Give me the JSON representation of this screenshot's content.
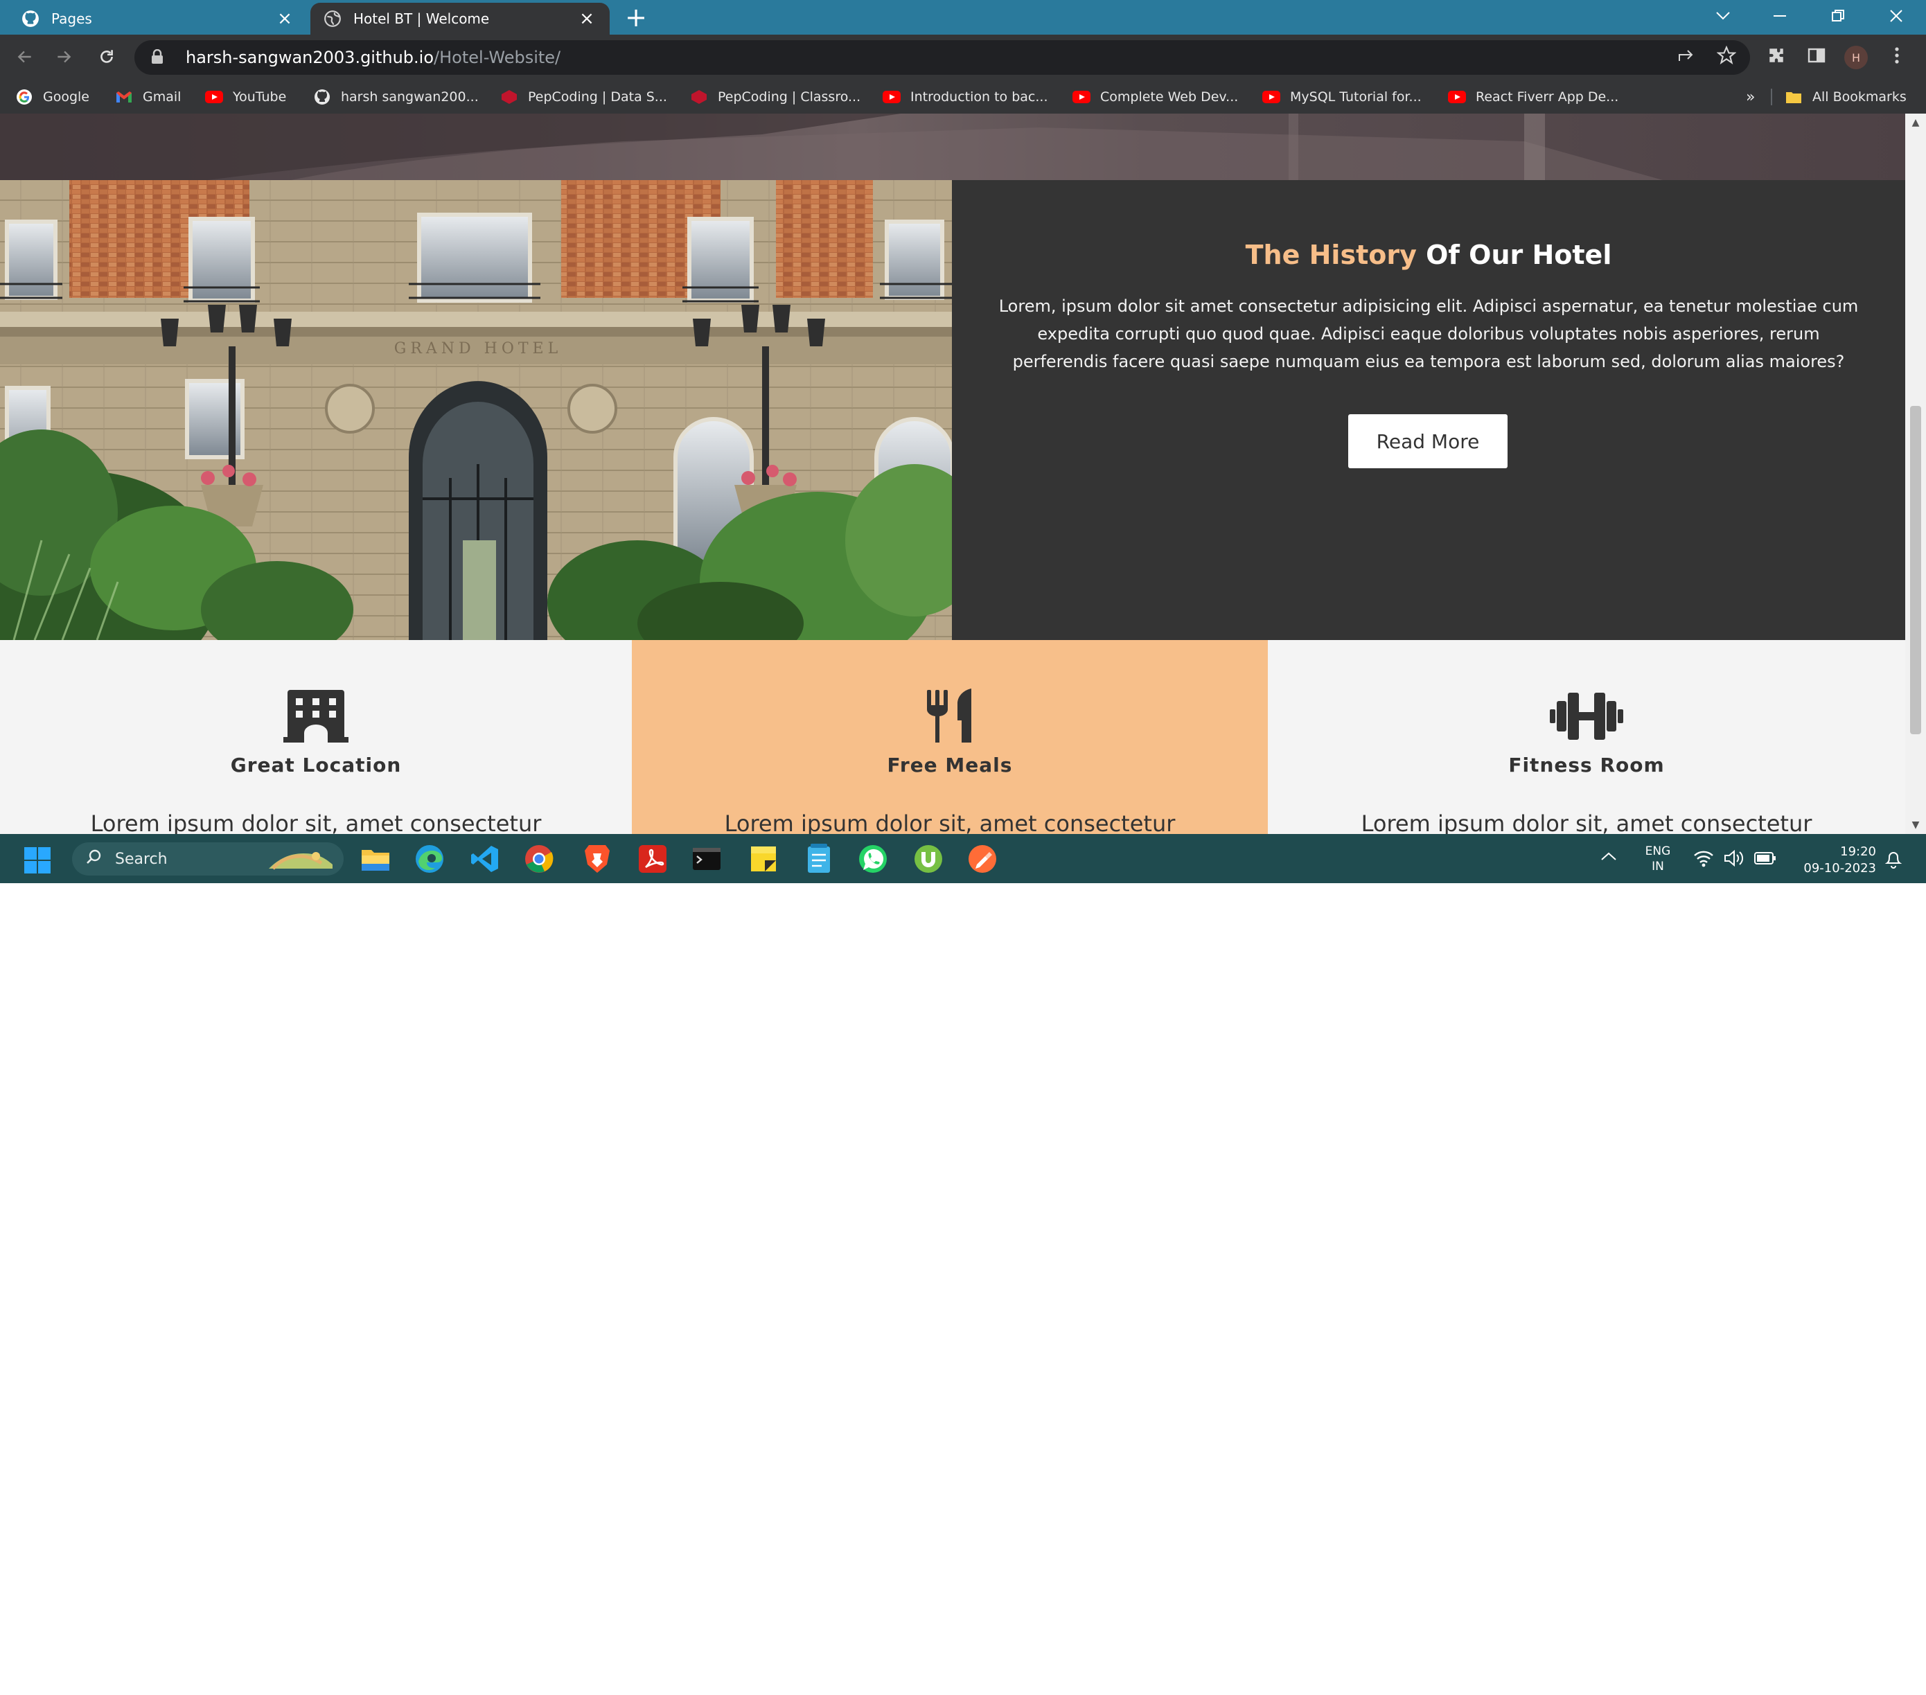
{
  "browser": {
    "tabs": [
      {
        "title": "Pages",
        "icon": "github-icon",
        "active": false
      },
      {
        "title": "Hotel BT | Welcome",
        "icon": "globe-icon",
        "active": true
      }
    ],
    "close_glyph": "×",
    "new_tab_glyph": "+",
    "url_host": "harsh-sangwan2003.github.io",
    "url_path": "/Hotel-Website/",
    "profile_initial": "H",
    "bookmarks": [
      {
        "label": "Google",
        "icon": "google-icon"
      },
      {
        "label": "Gmail",
        "icon": "gmail-icon"
      },
      {
        "label": "YouTube",
        "icon": "youtube-icon"
      },
      {
        "label": "harsh sangwan200...",
        "icon": "github-icon"
      },
      {
        "label": "PepCoding | Data S...",
        "icon": "pepcoding-icon"
      },
      {
        "label": "PepCoding | Classro...",
        "icon": "pepcoding-icon"
      },
      {
        "label": "Introduction to bac...",
        "icon": "youtube-icon"
      },
      {
        "label": "Complete Web Dev...",
        "icon": "youtube-icon"
      },
      {
        "label": "MySQL Tutorial for...",
        "icon": "youtube-icon"
      },
      {
        "label": "React Fiverr App De...",
        "icon": "youtube-icon"
      }
    ],
    "bookmarks_overflow": "»",
    "all_bookmarks": "All Bookmarks"
  },
  "page": {
    "history": {
      "title_accent": "The History",
      "title_rest": " Of Our Hotel",
      "text": "Lorem, ipsum dolor sit amet consectetur adipisicing elit. Adipisci aspernatur, ea tenetur molestiae cum expedita corrupti quo quod quae. Adipisci eaque doloribus voluptates nobis asperiores, rerum perferendis facere quasi saepe numquam eius ea tempora est laborum sed, dolorum alias maiores?",
      "button": "Read More",
      "sign_text": "GRAND HOTEL"
    },
    "features": [
      {
        "title": "Great Location",
        "text": "Lorem ipsum dolor sit, amet consectetur",
        "icon": "hotel-building-icon"
      },
      {
        "title": "Free Meals",
        "text": "Lorem ipsum dolor sit, amet consectetur",
        "icon": "utensils-icon"
      },
      {
        "title": "Fitness Room",
        "text": "Lorem ipsum dolor sit, amet consectetur",
        "icon": "dumbbell-icon"
      }
    ]
  },
  "taskbar": {
    "search_placeholder": "Search",
    "apps": [
      "file-explorer-icon",
      "edge-icon",
      "vscode-icon",
      "chrome-icon",
      "brave-icon",
      "acrobat-icon",
      "terminal-icon",
      "sticky-notes-icon",
      "notepad-icon",
      "whatsapp-icon",
      "utorrent-icon",
      "postman-icon"
    ],
    "lang_top": "ENG",
    "lang_bottom": "IN",
    "time": "19:20",
    "date": "09-10-2023"
  },
  "colors": {
    "accent": "#f7be89",
    "tabbar": "#2a7a9c",
    "panel": "#343434",
    "feature_highlight": "#f7bf8a",
    "taskbar": "#1f4b4f"
  }
}
